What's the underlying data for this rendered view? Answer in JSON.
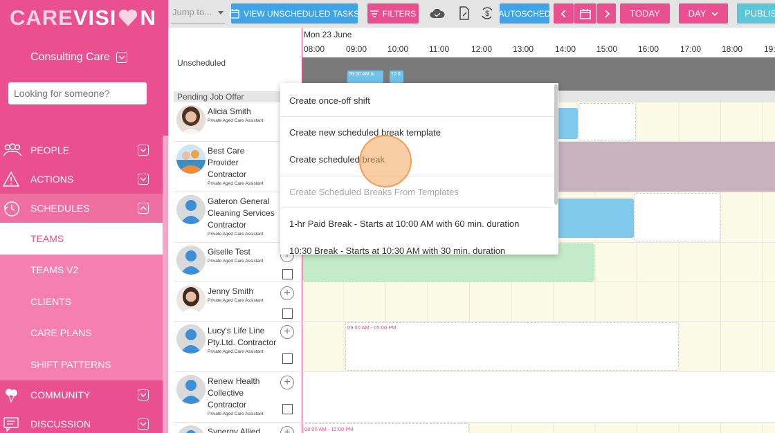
{
  "brand": {
    "logo_left": "CARE",
    "logo_right": "VISI",
    "logo_end": "N",
    "org_name": "Consulting Care"
  },
  "search": {
    "placeholder": "Looking for someone?"
  },
  "nav": {
    "people": "PEOPLE",
    "actions": "ACTIONS",
    "schedules": "SCHEDULES",
    "sub": [
      "TEAMS",
      "TEAMS V2",
      "CLIENTS",
      "CARE PLANS",
      "SHIFT PATTERNS"
    ],
    "community": "COMMUNITY",
    "discussion": "DISCUSSION"
  },
  "toolbar": {
    "jump_placeholder": "Jump to...",
    "view_unscheduled": "VIEW UNSCHEDULED TASKS",
    "filters": "FILTERS",
    "autosched": "AUTOSCHED",
    "today": "TODAY",
    "day": "DAY",
    "publish": "PUBLISH"
  },
  "list": {
    "unscheduled": "Unscheduled",
    "pending": "Pending Job Offer",
    "staff": [
      {
        "name": "Alicia Smith",
        "role": "Private Aged Care Assistant"
      },
      {
        "name": "Best Care Provider Contractor",
        "role": "Private Aged Care Assistant"
      },
      {
        "name": "Gateron General Cleaning Services Contractor",
        "role": "Private Aged Care Assistant"
      },
      {
        "name": "Giselle Test",
        "role": "Private Aged Care Assistant"
      },
      {
        "name": "Jenny Smith",
        "role": "Private Aged Care Assistant"
      },
      {
        "name": "Lucy's Life Line Pty.Ltd. Contractor",
        "role": "Private Aged Care Assistant"
      },
      {
        "name": "Renew Health Collective Contractor",
        "role": "Private Aged Care Assistant"
      },
      {
        "name": "Synergy Allied",
        "role": ""
      }
    ]
  },
  "timeline": {
    "date": "Mon 23 June",
    "hours": [
      "08:00",
      "09:00",
      "10:00",
      "11:00",
      "12:00",
      "13:00",
      "14:00",
      "15:00",
      "16:00",
      "17:00",
      "18:00",
      "19:"
    ],
    "mini_a": "09:00 AM to",
    "mini_b": "10:0",
    "shift_lucy": "09:00 AM - 05:00 PM",
    "shift_synergy": "08:00 AM - 12:00 PM"
  },
  "menu": {
    "once_off": "Create once-off shift",
    "new_template": "Create new scheduled break template",
    "scheduled_break": "Create scheduled break",
    "from_templates": "Create Scheduled Breaks From Templates",
    "template_1": "1-hr Paid Break - Starts at 10:00 AM with 60 min. duration",
    "template_2": "10:30 Break - Starts at 10:30 AM with 30 min. duration"
  }
}
